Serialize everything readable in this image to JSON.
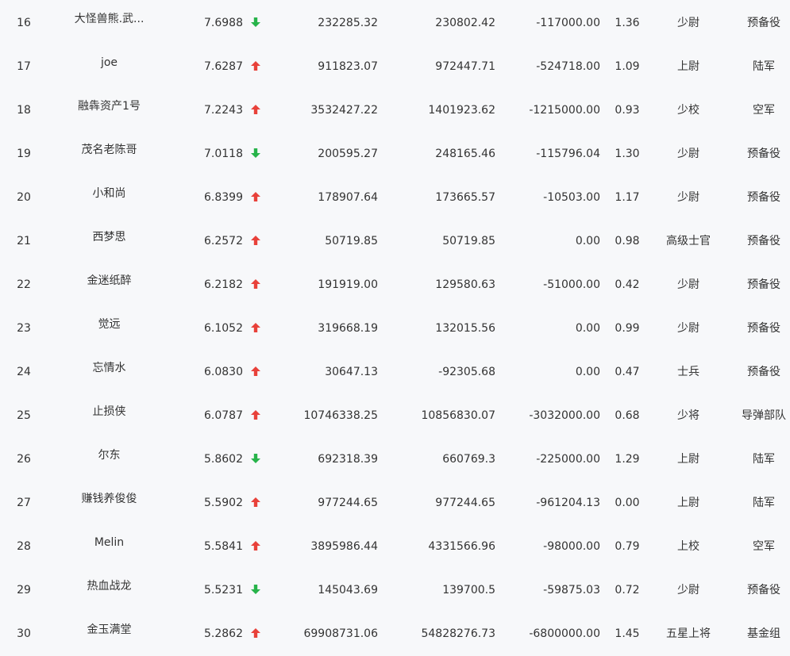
{
  "colors": {
    "up": "#e8413a",
    "down": "#27b34a",
    "text": "#333333",
    "background": "#f7f8fa"
  },
  "rows": [
    {
      "rank": "16",
      "name": "大怪兽熊.武...",
      "score": "7.6988",
      "trend": "down",
      "trend_icon": "arrow-down-icon",
      "v1": "232285.32",
      "v2": "230802.42",
      "v3": "-117000.00",
      "ratio": "1.36",
      "military_rank": "少尉",
      "unit": "预备役"
    },
    {
      "rank": "17",
      "name": "joe",
      "score": "7.6287",
      "trend": "up",
      "trend_icon": "arrow-up-icon",
      "v1": "911823.07",
      "v2": "972447.71",
      "v3": "-524718.00",
      "ratio": "1.09",
      "military_rank": "上尉",
      "unit": "陆军"
    },
    {
      "rank": "18",
      "name": "融犇资产1号",
      "score": "7.2243",
      "trend": "up",
      "trend_icon": "arrow-up-icon",
      "v1": "3532427.22",
      "v2": "1401923.62",
      "v3": "-1215000.00",
      "ratio": "0.93",
      "military_rank": "少校",
      "unit": "空军"
    },
    {
      "rank": "19",
      "name": "茂名老陈哥",
      "score": "7.0118",
      "trend": "down",
      "trend_icon": "arrow-down-icon",
      "v1": "200595.27",
      "v2": "248165.46",
      "v3": "-115796.04",
      "ratio": "1.30",
      "military_rank": "少尉",
      "unit": "预备役"
    },
    {
      "rank": "20",
      "name": "小和尚",
      "score": "6.8399",
      "trend": "up",
      "trend_icon": "arrow-up-icon",
      "v1": "178907.64",
      "v2": "173665.57",
      "v3": "-10503.00",
      "ratio": "1.17",
      "military_rank": "少尉",
      "unit": "预备役"
    },
    {
      "rank": "21",
      "name": "西梦思",
      "score": "6.2572",
      "trend": "up",
      "trend_icon": "arrow-up-icon",
      "v1": "50719.85",
      "v2": "50719.85",
      "v3": "0.00",
      "ratio": "0.98",
      "military_rank": "高级士官",
      "unit": "预备役"
    },
    {
      "rank": "22",
      "name": "金迷纸醉",
      "score": "6.2182",
      "trend": "up",
      "trend_icon": "arrow-up-icon",
      "v1": "191919.00",
      "v2": "129580.63",
      "v3": "-51000.00",
      "ratio": "0.42",
      "military_rank": "少尉",
      "unit": "预备役"
    },
    {
      "rank": "23",
      "name": "觉远",
      "score": "6.1052",
      "trend": "up",
      "trend_icon": "arrow-up-icon",
      "v1": "319668.19",
      "v2": "132015.56",
      "v3": "0.00",
      "ratio": "0.99",
      "military_rank": "少尉",
      "unit": "预备役"
    },
    {
      "rank": "24",
      "name": "忘情水",
      "score": "6.0830",
      "trend": "up",
      "trend_icon": "arrow-up-icon",
      "v1": "30647.13",
      "v2": "-92305.68",
      "v3": "0.00",
      "ratio": "0.47",
      "military_rank": "士兵",
      "unit": "预备役"
    },
    {
      "rank": "25",
      "name": "止损侠",
      "score": "6.0787",
      "trend": "up",
      "trend_icon": "arrow-up-icon",
      "v1": "10746338.25",
      "v2": "10856830.07",
      "v3": "-3032000.00",
      "ratio": "0.68",
      "military_rank": "少将",
      "unit": "导弹部队"
    },
    {
      "rank": "26",
      "name": "尔东",
      "score": "5.8602",
      "trend": "down",
      "trend_icon": "arrow-down-icon",
      "v1": "692318.39",
      "v2": "660769.3",
      "v3": "-225000.00",
      "ratio": "1.29",
      "military_rank": "上尉",
      "unit": "陆军"
    },
    {
      "rank": "27",
      "name": "赚钱养俊俊",
      "score": "5.5902",
      "trend": "up",
      "trend_icon": "arrow-up-icon",
      "v1": "977244.65",
      "v2": "977244.65",
      "v3": "-961204.13",
      "ratio": "0.00",
      "military_rank": "上尉",
      "unit": "陆军"
    },
    {
      "rank": "28",
      "name": "Melin",
      "score": "5.5841",
      "trend": "up",
      "trend_icon": "arrow-up-icon",
      "v1": "3895986.44",
      "v2": "4331566.96",
      "v3": "-98000.00",
      "ratio": "0.79",
      "military_rank": "上校",
      "unit": "空军"
    },
    {
      "rank": "29",
      "name": "热血战龙",
      "score": "5.5231",
      "trend": "down",
      "trend_icon": "arrow-down-icon",
      "v1": "145043.69",
      "v2": "139700.5",
      "v3": "-59875.03",
      "ratio": "0.72",
      "military_rank": "少尉",
      "unit": "预备役"
    },
    {
      "rank": "30",
      "name": "金玉满堂",
      "score": "5.2862",
      "trend": "up",
      "trend_icon": "arrow-up-icon",
      "v1": "69908731.06",
      "v2": "54828276.73",
      "v3": "-6800000.00",
      "ratio": "1.45",
      "military_rank": "五星上将",
      "unit": "基金组"
    }
  ]
}
